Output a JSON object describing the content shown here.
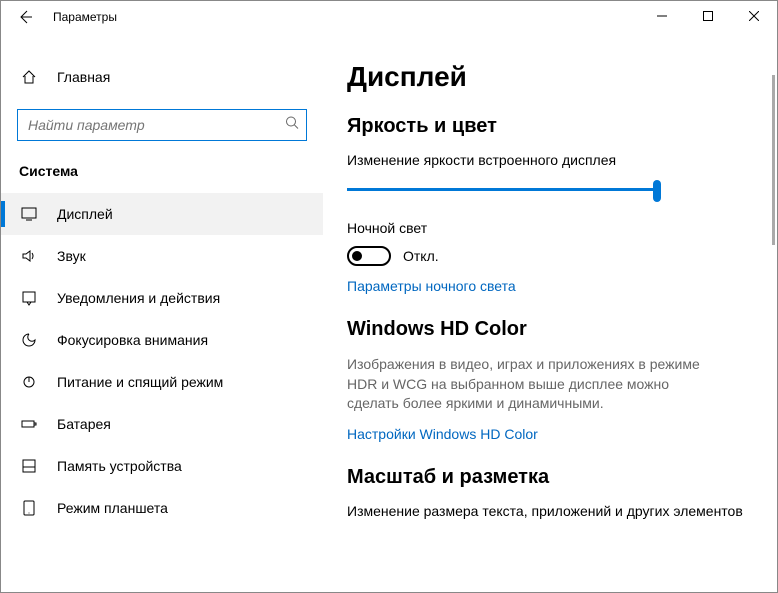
{
  "app": {
    "title": "Параметры"
  },
  "home": {
    "label": "Главная"
  },
  "search": {
    "placeholder": "Найти параметр"
  },
  "category": "Система",
  "nav": [
    {
      "label": "Дисплей",
      "icon": "display",
      "active": true
    },
    {
      "label": "Звук",
      "icon": "sound",
      "active": false
    },
    {
      "label": "Уведомления и действия",
      "icon": "notifications",
      "active": false
    },
    {
      "label": "Фокусировка внимания",
      "icon": "focus",
      "active": false
    },
    {
      "label": "Питание и спящий режим",
      "icon": "power",
      "active": false
    },
    {
      "label": "Батарея",
      "icon": "battery",
      "active": false
    },
    {
      "label": "Память устройства",
      "icon": "storage",
      "active": false
    },
    {
      "label": "Режим планшета",
      "icon": "tablet",
      "active": false
    }
  ],
  "content": {
    "title": "Дисплей",
    "brightness": {
      "heading": "Яркость и цвет",
      "slider_label": "Изменение яркости встроенного дисплея",
      "slider_value": 100,
      "nightlight_label": "Ночной свет",
      "toggle_state": "Откл.",
      "nightlight_link": "Параметры ночного света"
    },
    "hdcolor": {
      "heading": "Windows HD Color",
      "desc": "Изображения в видео, играх и приложениях в режиме HDR и WCG на выбранном выше дисплее можно сделать более яркими и динамичными.",
      "link": "Настройки Windows HD Color"
    },
    "scale": {
      "heading": "Масштаб и разметка",
      "label": "Изменение размера текста, приложений и других элементов"
    }
  }
}
